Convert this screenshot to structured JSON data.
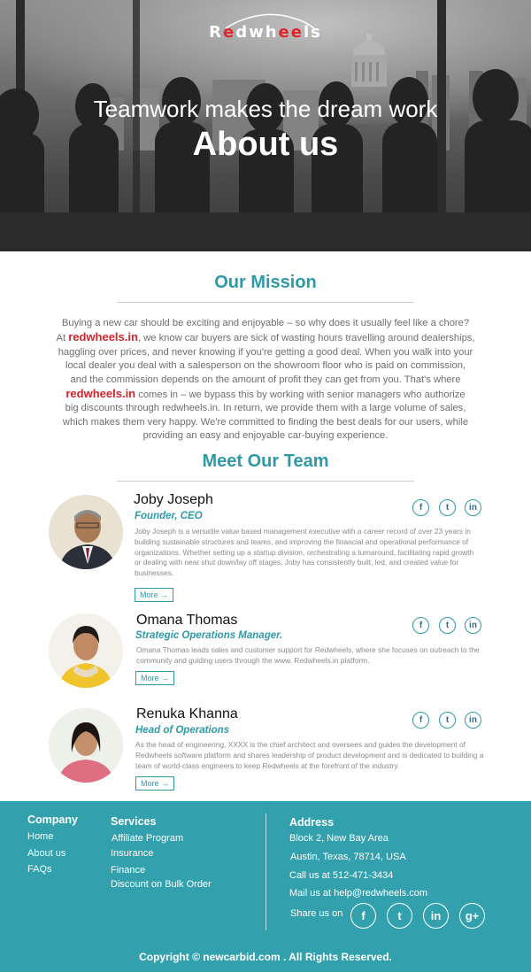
{
  "hero": {
    "logo": {
      "part1": "R",
      "accent1": "e",
      "part2": "dwh",
      "accent2": "ee",
      "part3": "ls"
    },
    "tagline": "Teamwork makes the dream work",
    "title": "About us"
  },
  "mission": {
    "title": "Our Mission",
    "line1": "Buying a new car should be exciting and enjoyable – so why does it usually feel like a chore?",
    "at": "At ",
    "brand": "redwheels.in",
    "line2": ", we know car buyers are sick of wasting hours travelling around dealerships,",
    "line3": "haggling over prices, and never knowing if you're getting a good deal. When you walk into your",
    "line4": "local dealer you deal with a salesperson on the showroom floor who is paid on commission,",
    "line5": "and the commission depends on the amount of profit they can get from you. That's where",
    "line6": " comes in – we bypass this by working with senior managers who authorize",
    "line7": "big discounts through redwheels.in. In return, we provide them with a large volume of sales,",
    "line8": "which makes them very happy. We're committed to finding the best deals for our users, while",
    "line9": "providing an easy and enjoyable car-buying experience."
  },
  "team": {
    "title": "Meet Our Team",
    "more_label": "More →",
    "social": {
      "facebook": "f",
      "twitter": "t",
      "linkedin": "in"
    },
    "members": [
      {
        "name": "Joby Joseph",
        "role": "Founder, CEO",
        "bio": "Joby Joseph is a versatile value based management executive with a career record of over 23 years in building sustainable structures and teams, and improving the financial and operational performance of organizations. Whether setting up a startup division, orchestrating a turnaround, facilitating rapid growth or dealing with near shut down/lay off stages, Joby has consistently built, led, and created value for businesses."
      },
      {
        "name": "Omana Thomas",
        "role": "Strategic Operations Manager.",
        "bio": "Omana Thomas leads sales and customer support for Redwheels, where she focuses on outreach to the community and guiding users through the www. Redwheels.in platform."
      },
      {
        "name": "Renuka Khanna",
        "role": "Head of Operations",
        "bio": "As the head of engineering, XXXX is the chief architect and oversees and guides the development of Redwheels software platform and shares leadership of product development and is dedicated to building a team of world-class engineers to keep Redwheels at the forefront of the industry."
      }
    ]
  },
  "footer": {
    "company": {
      "title": "Company",
      "links": [
        "Home",
        "About us",
        "FAQs"
      ]
    },
    "services": {
      "title": "Services",
      "links": [
        "Affiliate Program",
        "Insurance",
        "Finance",
        "Discount on Bulk Order"
      ]
    },
    "address": {
      "title": "Address",
      "lines": [
        "Block 2, New Bay Area",
        "Austin, Texas, 78714, USA",
        "Call us at 512-471-3434",
        "Mail us at help@redwheels.com"
      ],
      "share_label": "Share us on",
      "social": {
        "facebook": "f",
        "twitter": "t",
        "linkedin": "in",
        "googleplus": "g+"
      }
    },
    "copyright": "Copyright ©  newcarbid.com . All Rights Reserved."
  },
  "colors": {
    "accent": "#2e9aa7",
    "brand_red": "#d4242a",
    "footer_bg": "#33a0ad"
  }
}
